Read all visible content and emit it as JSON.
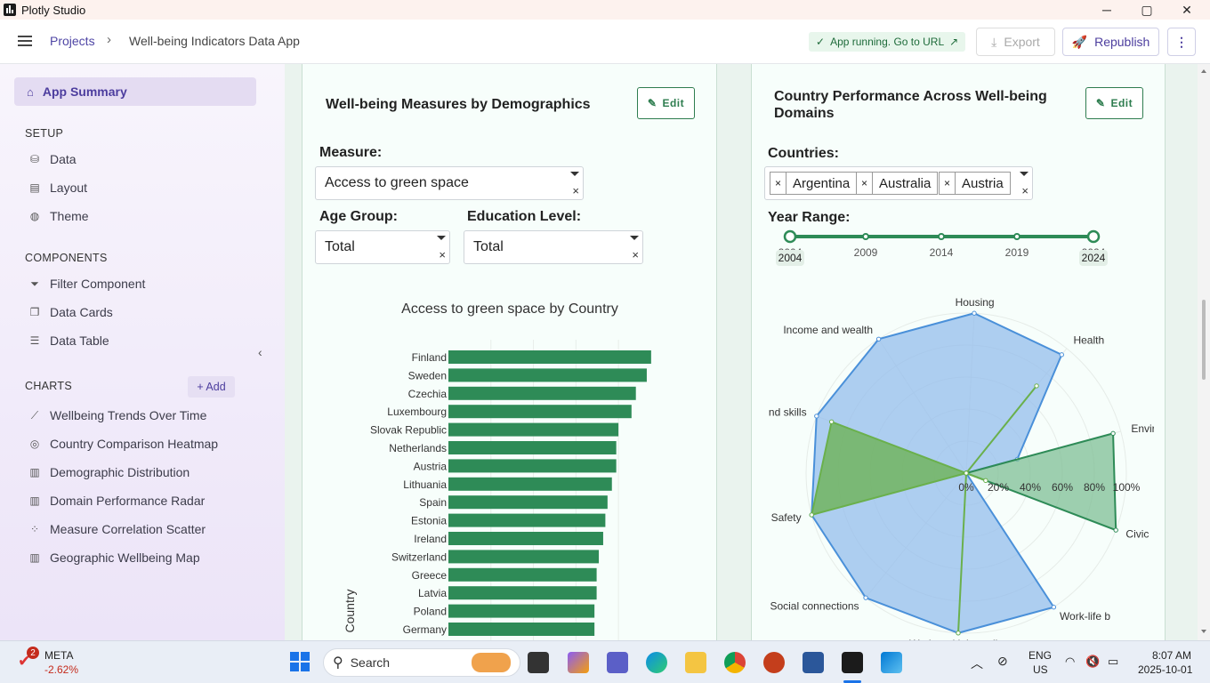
{
  "window": {
    "title": "Plotly Studio",
    "minimize": "─",
    "maximize": "▢",
    "close": "✕"
  },
  "appbar": {
    "breadcrumb_root": "Projects",
    "breadcrumb_sep": "›",
    "breadcrumb_current": "Well-being Indicators Data App",
    "status": "App running. Go to URL",
    "export": "Export",
    "republish": "Republish",
    "more": "⋮"
  },
  "sidebar": {
    "active": "App Summary",
    "setup_title": "SETUP",
    "setup": [
      {
        "label": "Data",
        "icon": "database-icon"
      },
      {
        "label": "Layout",
        "icon": "layout-icon"
      },
      {
        "label": "Theme",
        "icon": "palette-icon"
      }
    ],
    "components_title": "COMPONENTS",
    "components": [
      {
        "label": "Filter Component",
        "icon": "filter-icon"
      },
      {
        "label": "Data Cards",
        "icon": "cards-icon"
      },
      {
        "label": "Data Table",
        "icon": "table-icon"
      }
    ],
    "charts_title": "CHARTS",
    "add": "+ Add",
    "charts": [
      {
        "label": "Wellbeing Trends Over Time",
        "icon": "line-chart-icon"
      },
      {
        "label": "Country Comparison Heatmap",
        "icon": "globe-icon"
      },
      {
        "label": "Demographic Distribution",
        "icon": "bar-chart-icon"
      },
      {
        "label": "Domain Performance Radar",
        "icon": "bar-chart-icon"
      },
      {
        "label": "Measure Correlation Scatter",
        "icon": "scatter-icon"
      },
      {
        "label": "Geographic Wellbeing Map",
        "icon": "bar-chart-icon"
      }
    ]
  },
  "card1": {
    "title": "Well-being Measures by Demographics",
    "edit": "Edit",
    "measure_label": "Measure:",
    "measure_value": "Access to green space",
    "age_label": "Age Group:",
    "age_value": "Total",
    "edu_label": "Education Level:",
    "edu_value": "Total",
    "clear": "×"
  },
  "card2": {
    "title_line1": "Country Performance Across Well-being",
    "title_line2": "Domains",
    "edit": "Edit",
    "countries_label": "Countries:",
    "countries": [
      "Argentina",
      "Australia",
      "Austria"
    ],
    "year_label": "Year Range:",
    "years": [
      "2004",
      "2009",
      "2014",
      "2019",
      "2024"
    ],
    "year_start": "2004",
    "year_end": "2024"
  },
  "chart_data": [
    {
      "type": "bar",
      "orientation": "horizontal",
      "title": "Access to green space by Country",
      "ylabel": "Country",
      "categories": [
        "Finland",
        "Sweden",
        "Czechia",
        "Luxembourg",
        "Slovak Republic",
        "Netherlands",
        "Austria",
        "Lithuania",
        "Spain",
        "Estonia",
        "Ireland",
        "Switzerland",
        "Greece",
        "Latvia",
        "Poland",
        "Germany"
      ],
      "values": [
        93,
        91,
        86,
        84,
        78,
        77,
        77,
        75,
        73,
        72,
        71,
        69,
        68,
        68,
        67,
        67
      ],
      "xlim": [
        0,
        100
      ],
      "color": "#2e8b57"
    },
    {
      "type": "radar",
      "axes": [
        "Housing",
        "Health",
        "Environment",
        "Civic",
        "Work-life balance",
        "Work and job quality",
        "Social connections",
        "Safety",
        "Knowledge and skills",
        "Income and wealth"
      ],
      "axes_display": [
        "Housing",
        "Health",
        "Environme",
        "Civic",
        "Work-life b",
        "Work and job quality",
        "Social connections",
        "Safety",
        "nd skills",
        "Income and wealth"
      ],
      "radial_ticks": [
        "0%",
        "20%",
        "40%",
        "60%",
        "80%",
        "100%"
      ],
      "series": [
        {
          "color": "#4a90d9",
          "fill": "#94bdec",
          "values": [
            100,
            95,
            33,
            0,
            100,
            100,
            100,
            100,
            100,
            100
          ]
        },
        {
          "color": "#2e8b57",
          "fill": "#7fbf95",
          "values": [
            0,
            0,
            95,
            100,
            0,
            0,
            0,
            0,
            0,
            0
          ]
        },
        {
          "color": "#6ab04c",
          "fill": "#6ab04c",
          "values": [
            0,
            70,
            0,
            13,
            0,
            100,
            0,
            100,
            90,
            0
          ]
        }
      ]
    }
  ],
  "taskbar": {
    "stock_name": "META",
    "stock_change": "-2.62%",
    "badge": "2",
    "search": "Search",
    "lang1": "ENG",
    "lang2": "US",
    "time": "8:07 AM",
    "date": "2025-10-01"
  }
}
